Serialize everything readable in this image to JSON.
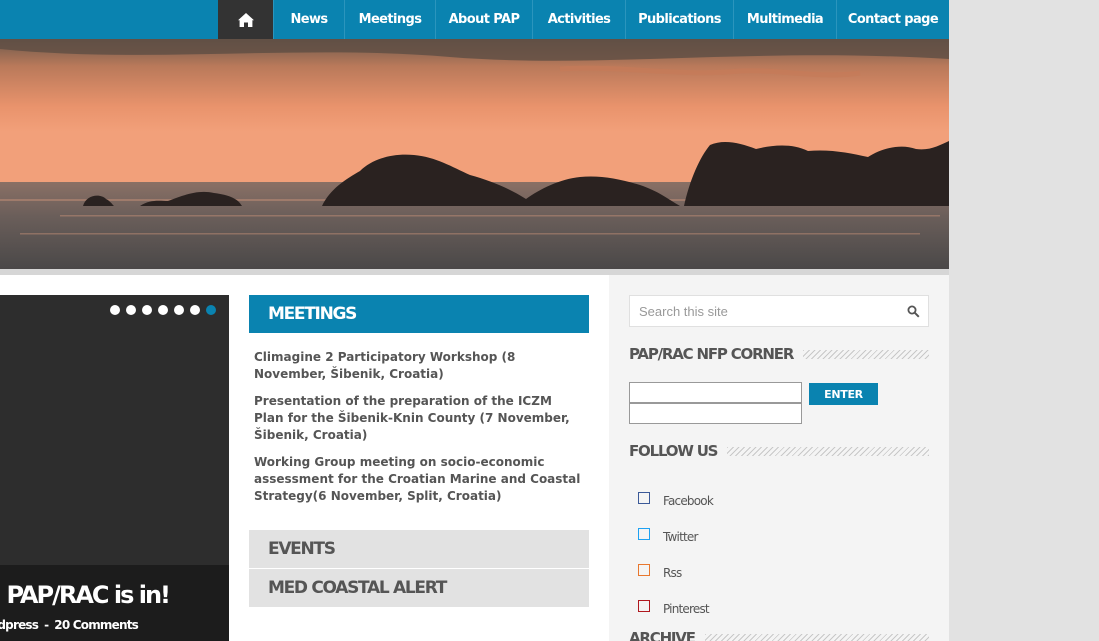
{
  "nav": {
    "home_icon": "home-icon",
    "items": [
      "News",
      "Meetings",
      "About PAP",
      "Activities",
      "Publications",
      "Multimedia",
      "Contact page"
    ]
  },
  "slider": {
    "dot_count": 7,
    "active_dot": 6,
    "title": "on: PAP/RAC is in!",
    "meta_category": "Wordpress",
    "meta_separator": "-",
    "meta_comments": "20 Comments"
  },
  "tabs": {
    "meetings": {
      "title": "MEETINGS",
      "items": [
        "Climagine 2 Participatory Workshop (8 November, Šibenik, Croatia)",
        "Presentation of the preparation of the ICZM Plan for the Šibenik-Knin County (7 November, Šibenik, Croatia)",
        "Working Group meeting on socio-economic assessment for the Croatian Marine and Coastal Strategy(6 November, Split, Croatia)"
      ]
    },
    "events": {
      "title": "EVENTS"
    },
    "alert": {
      "title": "MED COASTAL ALERT"
    }
  },
  "sidebar": {
    "search": {
      "placeholder": "Search this site",
      "icon": "search-icon"
    },
    "nfp": {
      "title": "PAP/RAC NFP CORNER",
      "button_label": "ENTER"
    },
    "follow": {
      "title": "FOLLOW US",
      "items": [
        {
          "label": "Facebook",
          "color": "#3b5998"
        },
        {
          "label": "Twitter",
          "color": "#1da1f2"
        },
        {
          "label": "Rss",
          "color": "#e8772e"
        },
        {
          "label": "Pinterest",
          "color": "#b0181f"
        }
      ]
    },
    "archive": {
      "title": "ARCHIVE"
    }
  },
  "colors": {
    "accent": "#0a83b0",
    "nav_home_bg": "#333333",
    "text_gray": "#555555"
  }
}
